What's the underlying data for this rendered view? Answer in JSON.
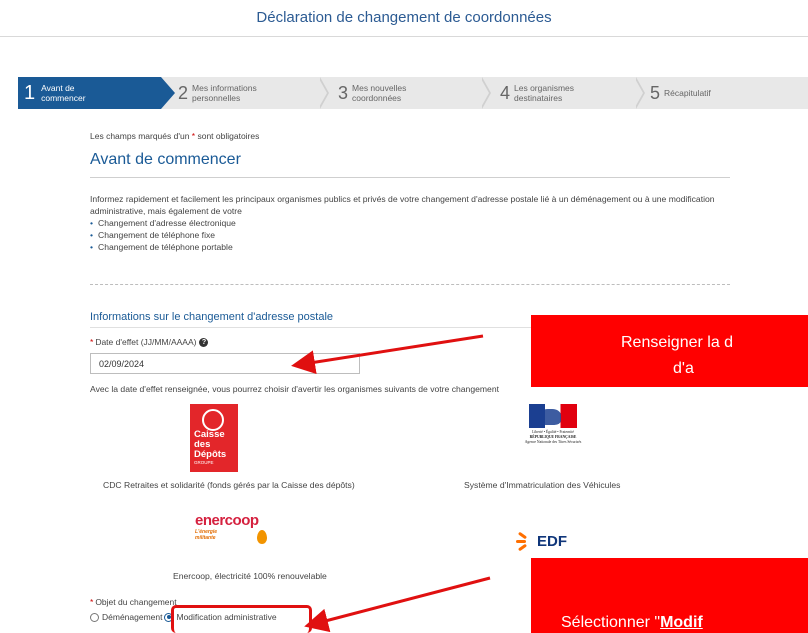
{
  "header": {
    "title": "Déclaration de changement de coordonnées"
  },
  "stepper": {
    "steps": [
      {
        "number": "1",
        "label_line1": "Avant de",
        "label_line2": "commencer"
      },
      {
        "number": "2",
        "label_line1": "Mes informations",
        "label_line2": "personnelles"
      },
      {
        "number": "3",
        "label_line1": "Mes nouvelles",
        "label_line2": "coordonnées"
      },
      {
        "number": "4",
        "label_line1": "Les organismes",
        "label_line2": "destinataires"
      },
      {
        "number": "5",
        "label_line1": "Récapitulatif",
        "label_line2": ""
      }
    ],
    "active_step": 1
  },
  "form": {
    "required_note_before": "Les champs marqués d'un ",
    "required_star": "*",
    "required_note_after": " sont obligatoires",
    "section_title": "Avant de commencer",
    "intro": "Informez rapidement et facilement les principaux organismes publics et privés de votre changement d'adresse postale lié à un déménagement ou à une modification administrative, mais également de votre",
    "bullets": [
      "Changement d'adresse électronique",
      "Changement de téléphone fixe",
      "Changement de téléphone portable"
    ],
    "postal_title": "Informations sur le changement d'adresse postale",
    "date_label": "Date d'effet (JJ/MM/AAAA)",
    "date_value": "02/09/2024",
    "available_text": "Avec la date d'effet renseignée, vous pourrez choisir d'avertir les organismes suivants de votre changement",
    "organisations": [
      {
        "caption": "CDC Retraites et solidarité (fonds gérés par la Caisse des dépôts)",
        "logo_line1": "Caisse",
        "logo_line2": "des Dépôts",
        "logo_line3": "GROUPE"
      },
      {
        "caption": "Système d'Immatriculation des Véhicules",
        "logo_line1": "Liberté • Égalité • Fraternité",
        "logo_line2": "RÉPUBLIQUE FRANÇAISE",
        "logo_line3": "Agence Nationale des Titres Sécurisés"
      },
      {
        "caption": "Enercoop, électricité 100% renouvelable",
        "logo_line1": "enercoop",
        "logo_line2": "L'énergie",
        "logo_line3": "militante"
      },
      {
        "caption": "",
        "logo_line1": "EDF"
      }
    ],
    "objet_label": "Objet du changement",
    "objet_options": [
      {
        "label": "Déménagement",
        "checked": false
      },
      {
        "label": "Modification administrative",
        "checked": true
      }
    ]
  },
  "annotations": {
    "callout_1_line1": "Renseigner la d",
    "callout_1_line2": "d'a",
    "callout_2_prefix": "Sélectionner \"",
    "callout_2_bold": "Modif"
  },
  "colors": {
    "primary": "#1a5a96",
    "title": "#2c5b93",
    "callout": "#ff0000",
    "required": "#cc0000"
  }
}
